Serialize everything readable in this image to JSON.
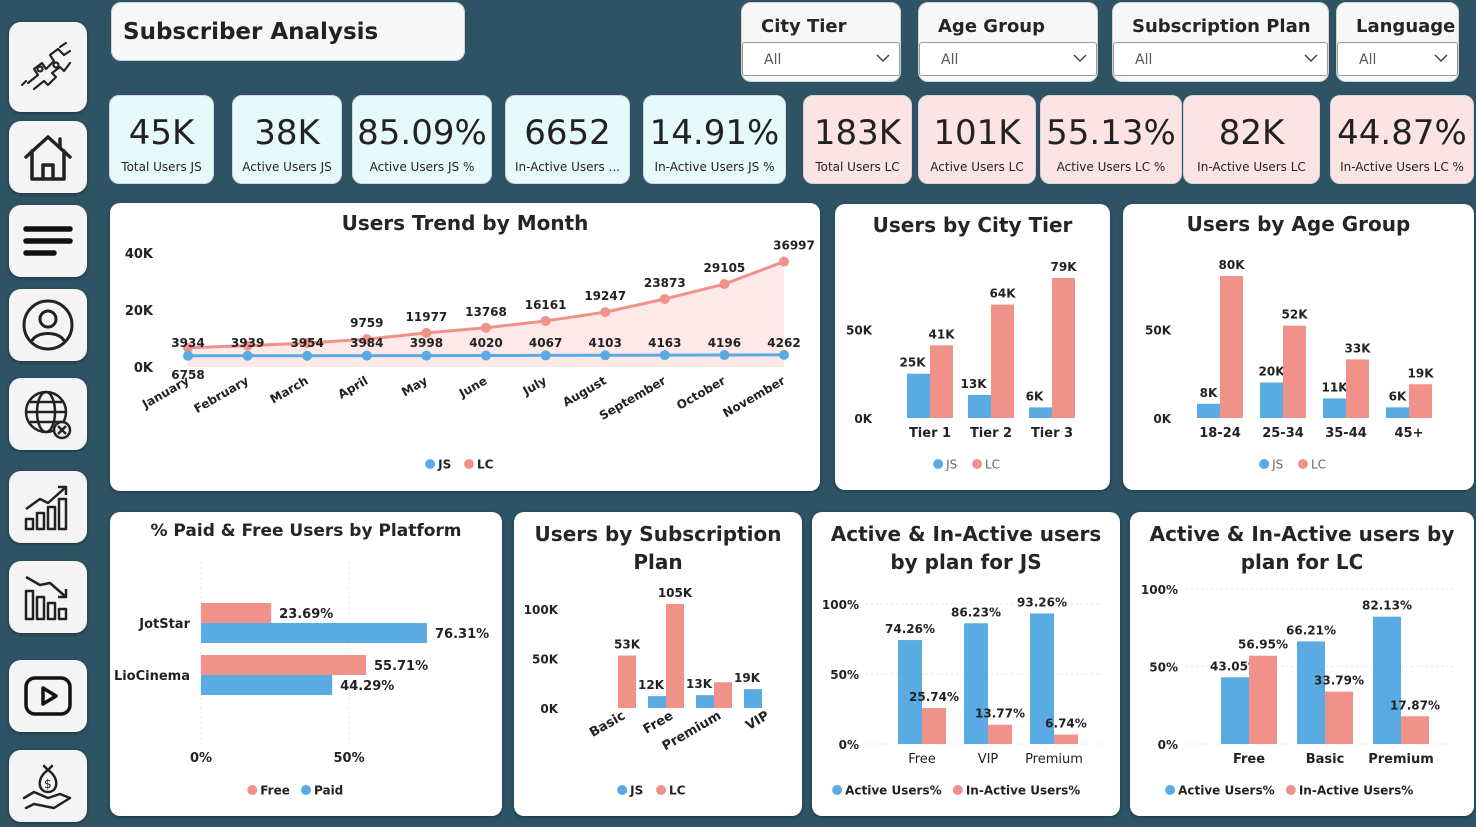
{
  "title": "Subscriber Analysis",
  "slicers": [
    {
      "label": "City Tier",
      "value": "All"
    },
    {
      "label": "Age Group",
      "value": "All"
    },
    {
      "label": "Subscription Plan",
      "value": "All"
    },
    {
      "label": "Language",
      "value": "All"
    }
  ],
  "nav_icons": [
    "puzzle-icon",
    "home-icon",
    "menu-icon",
    "user-icon",
    "globe-icon",
    "growth-chart-icon",
    "decline-chart-icon",
    "play-icon",
    "money-hand-icon"
  ],
  "kpis": [
    {
      "value": "45K",
      "label": "Total Users JS",
      "group": "js"
    },
    {
      "value": "38K",
      "label": "Active Users JS",
      "group": "js"
    },
    {
      "value": "85.09%",
      "label": "Active Users JS %",
      "group": "js"
    },
    {
      "value": "6652",
      "label": "In-Active Users ...",
      "group": "js"
    },
    {
      "value": "14.91%",
      "label": "In-Active Users JS %",
      "group": "js"
    },
    {
      "value": "183K",
      "label": "Total Users LC",
      "group": "lc"
    },
    {
      "value": "101K",
      "label": "Active Users LC",
      "group": "lc"
    },
    {
      "value": "55.13%",
      "label": "Active Users LC %",
      "group": "lc"
    },
    {
      "value": "82K",
      "label": "In-Active Users LC",
      "group": "lc"
    },
    {
      "value": "44.87%",
      "label": "In-Active Users LC %",
      "group": "lc"
    }
  ],
  "colors": {
    "js": "#5aabe3",
    "lc": "#f0928a",
    "lc_area": "#fde9e8",
    "background": "#2e5365"
  },
  "chart_data": [
    {
      "id": "trend",
      "type": "line",
      "title": "Users Trend by Month",
      "categories": [
        "January",
        "February",
        "March",
        "April",
        "May",
        "June",
        "July",
        "August",
        "September",
        "October",
        "November"
      ],
      "series": [
        {
          "name": "JS",
          "values": [
            3934,
            3939,
            3954,
            3984,
            3998,
            4020,
            4067,
            4103,
            4163,
            4196,
            4262
          ]
        },
        {
          "name": "LC",
          "values": [
            6758,
            7500,
            8400,
            9759,
            11977,
            13768,
            16161,
            19247,
            23873,
            29105,
            36997
          ]
        }
      ],
      "lc_labels": [
        "6758",
        "",
        "",
        "9759",
        "11977",
        "13768",
        "16161",
        "19247",
        "23873",
        "29105",
        "36997"
      ],
      "y_ticks": [
        "0K",
        "20K",
        "40K"
      ],
      "ylim": [
        0,
        40000
      ],
      "legend": "bottom"
    },
    {
      "id": "city",
      "type": "bar",
      "title": "Users by City Tier",
      "categories": [
        "Tier 1",
        "Tier 2",
        "Tier 3"
      ],
      "series": [
        {
          "name": "JS",
          "values": [
            25000,
            13000,
            6000
          ],
          "labels": [
            "25K",
            "13K",
            "6K"
          ]
        },
        {
          "name": "LC",
          "values": [
            41000,
            64000,
            79000
          ],
          "labels": [
            "41K",
            "64K",
            "79K"
          ]
        }
      ],
      "y_ticks": [
        "0K",
        "50K"
      ],
      "ylim": [
        0,
        79000
      ],
      "legend": "bottom"
    },
    {
      "id": "age",
      "type": "bar",
      "title": "Users by Age Group",
      "categories": [
        "18-24",
        "25-34",
        "35-44",
        "45+"
      ],
      "series": [
        {
          "name": "JS",
          "values": [
            8000,
            20000,
            11000,
            6000
          ],
          "labels": [
            "8K",
            "20K",
            "11K",
            "6K"
          ]
        },
        {
          "name": "LC",
          "values": [
            80000,
            52000,
            33000,
            19000
          ],
          "labels": [
            "80K",
            "52K",
            "33K",
            "19K"
          ]
        }
      ],
      "y_ticks": [
        "0K",
        "50K"
      ],
      "ylim": [
        0,
        80000
      ],
      "legend": "bottom"
    },
    {
      "id": "platform",
      "type": "bar",
      "orientation": "horizontal",
      "title": "% Paid & Free Users by Platform",
      "categories": [
        "JotStar",
        "LioCinema"
      ],
      "series": [
        {
          "name": "Free",
          "values": [
            23.69,
            55.71
          ],
          "labels": [
            "23.69%",
            "55.71%"
          ]
        },
        {
          "name": "Paid",
          "values": [
            76.31,
            44.29
          ],
          "labels": [
            "76.31%",
            "44.29%"
          ]
        }
      ],
      "x_ticks": [
        "0%",
        "50%"
      ],
      "xlim": [
        0,
        76.31
      ],
      "legend": "bottom"
    },
    {
      "id": "plan",
      "type": "bar",
      "title": "Users by Subscription Plan",
      "categories": [
        "Basic",
        "Free",
        "Premium",
        "VIP"
      ],
      "series": [
        {
          "name": "JS",
          "values": [
            0,
            12000,
            13000,
            19000
          ],
          "labels": [
            "",
            "12K",
            "13K",
            "19K"
          ]
        },
        {
          "name": "LC",
          "values": [
            53000,
            105000,
            26000,
            0
          ],
          "labels": [
            "53K",
            "105K",
            "",
            ""
          ]
        }
      ],
      "y_ticks": [
        "0K",
        "50K",
        "100K"
      ],
      "ylim": [
        0,
        105000
      ],
      "legend": "bottom"
    },
    {
      "id": "js_plan",
      "type": "bar",
      "title": "Active & In-Active users by plan for JS",
      "categories": [
        "Free",
        "VIP",
        "Premium"
      ],
      "series": [
        {
          "name": "Active Users%",
          "values": [
            74.26,
            86.23,
            93.26
          ],
          "labels": [
            "74.26%",
            "86.23%",
            "93.26%"
          ]
        },
        {
          "name": "In-Active Users%",
          "values": [
            25.74,
            13.77,
            6.74
          ],
          "labels": [
            "25.74%",
            "13.77%",
            "6.74%"
          ]
        }
      ],
      "y_ticks": [
        "0%",
        "50%",
        "100%"
      ],
      "ylim": [
        0,
        100
      ],
      "legend": "bottom"
    },
    {
      "id": "lc_plan",
      "type": "bar",
      "title": "Active & In-Active users by plan for LC",
      "categories": [
        "Free",
        "Basic",
        "Premium"
      ],
      "series": [
        {
          "name": "Active Users%",
          "values": [
            43.05,
            66.21,
            82.13
          ],
          "labels": [
            "43.05%",
            "66.21%",
            "82.13%"
          ]
        },
        {
          "name": "In-Active Users%",
          "values": [
            56.95,
            33.79,
            17.87
          ],
          "labels": [
            "56.95%",
            "33.79%",
            "17.87%"
          ]
        }
      ],
      "y_ticks": [
        "0%",
        "50%",
        "100%"
      ],
      "ylim": [
        0,
        100
      ],
      "legend": "bottom"
    }
  ]
}
